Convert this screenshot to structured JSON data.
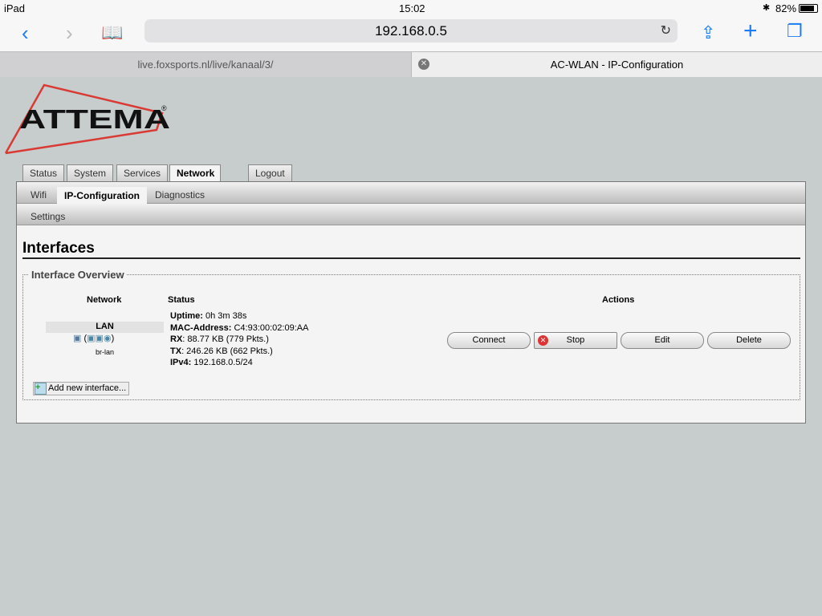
{
  "statusbar": {
    "device": "iPad",
    "time": "15:02",
    "battery": "82%"
  },
  "browser": {
    "url": "192.168.0.5",
    "tabs": [
      {
        "label": "live.foxsports.nl/live/kanaal/3/"
      },
      {
        "label": "AC-WLAN - IP-Configuration"
      }
    ]
  },
  "logo": {
    "text": "ATTEMA",
    "mark": "®",
    "colors": {
      "triangle": "#d93a34"
    }
  },
  "nav": {
    "tabs": [
      "Status",
      "System",
      "Services",
      "Network",
      "Logout"
    ],
    "active": "Network",
    "subtabs": [
      "Wifi",
      "IP-Configuration",
      "Diagnostics"
    ],
    "active_sub": "IP-Configuration",
    "subsub": [
      "Settings"
    ]
  },
  "page": {
    "title": "Interfaces",
    "legend": "Interface Overview",
    "headers": {
      "network": "Network",
      "status": "Status",
      "actions": "Actions"
    },
    "interface": {
      "name": "LAN",
      "device": "br-lan",
      "paren_open": "(",
      "paren_close": ")",
      "status": [
        {
          "k": "Uptime:",
          "v": " 0h 3m 38s"
        },
        {
          "k": "MAC-Address:",
          "v": " C4:93:00:02:09:AA"
        },
        {
          "k": "RX",
          "v": ": 88.77 KB (779 Pkts.)"
        },
        {
          "k": "TX",
          "v": ": 246.26 KB (662 Pkts.)"
        },
        {
          "k": "IPv4:",
          "v": " 192.168.0.5/24"
        }
      ]
    },
    "actions": {
      "connect": "Connect",
      "stop": "Stop",
      "edit": "Edit",
      "delete": "Delete"
    },
    "add": "Add new interface..."
  }
}
